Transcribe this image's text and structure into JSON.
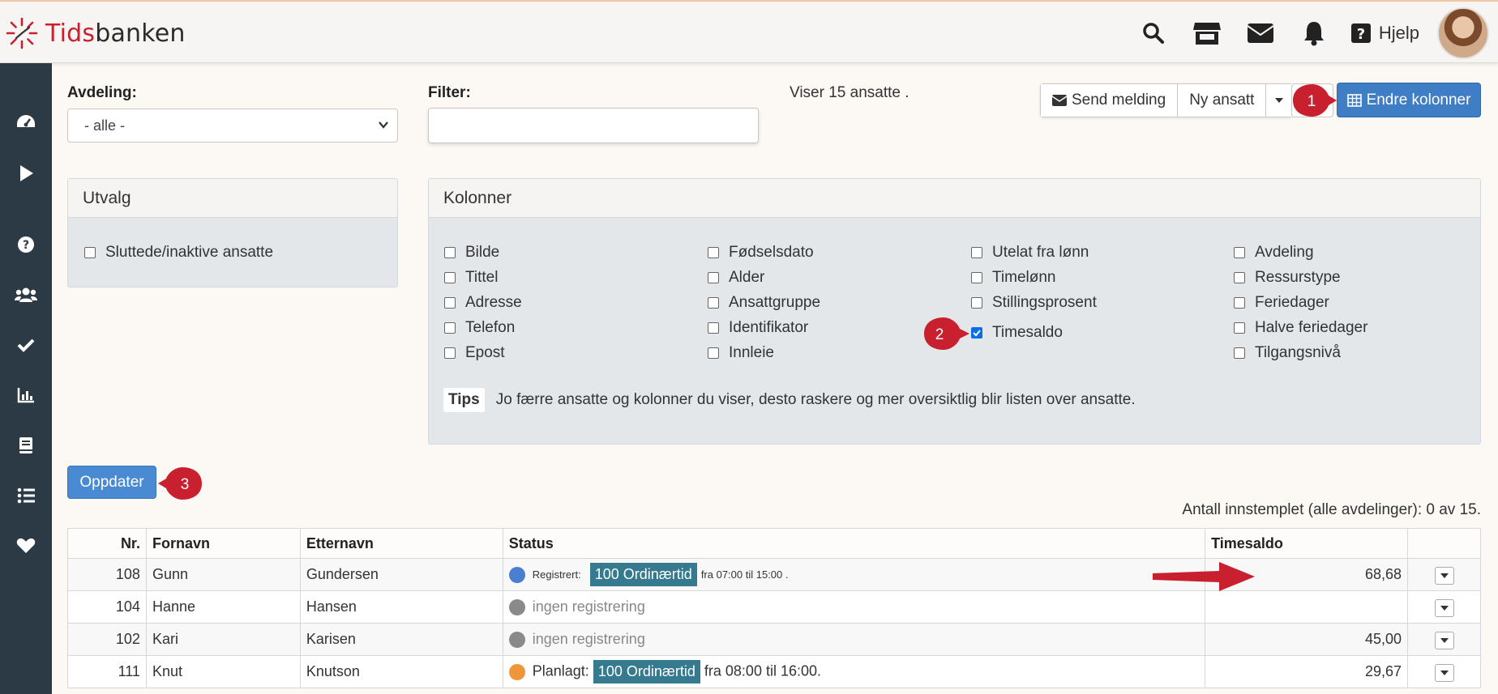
{
  "brand": {
    "part1": "Tids",
    "part2": "banken"
  },
  "header": {
    "help_label": "Hjelp"
  },
  "icons": {
    "search": "search-icon",
    "store": "store-icon",
    "mail": "envelope-icon",
    "bell": "bell-icon",
    "help": "question-square-icon"
  },
  "sidebar": {
    "items": [
      "dashboard-icon",
      "play-icon",
      "help-icon",
      "users-icon",
      "check-icon",
      "chart-icon",
      "book-icon",
      "list-icon",
      "heart-icon"
    ]
  },
  "filters": {
    "department_label": "Avdeling:",
    "department_value": "- alle -",
    "filter_label": "Filter:",
    "filter_value": "",
    "showing_text": "Viser 15 ansatte ."
  },
  "toolbar": {
    "send_message": "Send melding",
    "new_employee": "Ny ansatt",
    "change_columns": "Endre kolonner"
  },
  "selection_panel": {
    "title": "Utvalg",
    "option": "Sluttede/inaktive ansatte"
  },
  "columns_panel": {
    "title": "Kolonner",
    "col1": [
      "Bilde",
      "Tittel",
      "Adresse",
      "Telefon",
      "Epost"
    ],
    "col2": [
      "Fødselsdato",
      "Alder",
      "Ansattgruppe",
      "Identifikator",
      "Innleie"
    ],
    "col3": [
      "Utelat fra lønn",
      "Timelønn",
      "Stillingsprosent",
      "Timesaldo"
    ],
    "col4": [
      "Avdeling",
      "Ressurstype",
      "Feriedager",
      "Halve feriedager",
      "Tilgangsnivå"
    ],
    "checked": "Timesaldo",
    "tips_label": "Tips",
    "tips_text": "Jo færre ansatte og kolonner du viser, desto raskere og mer oversiktlig blir listen over ansatte."
  },
  "update_button": "Oppdater",
  "count_line": "Antall innstemplet (alle avdelinger): 0 av 15.",
  "table": {
    "headers": [
      "Nr.",
      "Fornavn",
      "Etternavn",
      "Status",
      "Timesaldo"
    ],
    "rows": [
      {
        "nr": "108",
        "first": "Gunn",
        "last": "Gundersen",
        "status_kind": "registered",
        "status_prefix": "Registrert:",
        "tag": "100 Ordinærtid",
        "status_suffix": "fra 07:00 til 15:00 .",
        "balance": "68,68"
      },
      {
        "nr": "104",
        "first": "Hanne",
        "last": "Hansen",
        "status_kind": "none",
        "status_prefix": "ingen registrering",
        "tag": "",
        "status_suffix": "",
        "balance": ""
      },
      {
        "nr": "102",
        "first": "Kari",
        "last": "Karisen",
        "status_kind": "none",
        "status_prefix": "ingen registrering",
        "tag": "",
        "status_suffix": "",
        "balance": "45,00"
      },
      {
        "nr": "111",
        "first": "Knut",
        "last": "Knutson",
        "status_kind": "planned",
        "status_prefix": "Planlagt:",
        "tag": "100 Ordinærtid",
        "status_suffix": "fra 08:00 til 16:00.",
        "balance": "29,67"
      }
    ]
  },
  "callouts": [
    "1",
    "2",
    "3"
  ],
  "colors": {
    "primary": "#3f7dc4",
    "sidebar": "#2b3a44",
    "tag": "#357a8f",
    "callout": "#c8202f",
    "registered_dot": "#4a7fd0",
    "none_dot": "#8a8a8a",
    "planned_dot": "#f0963a"
  }
}
